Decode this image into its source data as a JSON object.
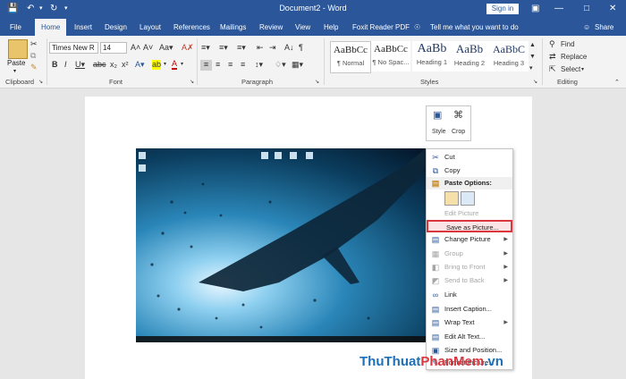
{
  "titlebar": {
    "title": "Document2 - Word",
    "sign_in": "Sign in"
  },
  "tabs": [
    "File",
    "Home",
    "Insert",
    "Design",
    "Layout",
    "References",
    "Mailings",
    "Review",
    "View",
    "Help",
    "Foxit Reader PDF"
  ],
  "tell_me": "Tell me what you want to do",
  "share": "Share",
  "ribbon": {
    "clipboard": {
      "paste": "Paste",
      "label": "Clipboard"
    },
    "font": {
      "name": "Times New R",
      "size": "14",
      "label": "Font"
    },
    "paragraph": {
      "label": "Paragraph"
    },
    "styles": {
      "label": "Styles",
      "items": [
        {
          "preview": "AaBbCc",
          "name": "¶ Normal"
        },
        {
          "preview": "AaBbCc",
          "name": "¶ No Spac..."
        },
        {
          "preview": "AaBb",
          "name": "Heading 1"
        },
        {
          "preview": "AaBb",
          "name": "Heading 2"
        },
        {
          "preview": "AaBbC",
          "name": "Heading 3"
        }
      ]
    },
    "editing": {
      "find": "Find",
      "replace": "Replace",
      "select": "Select",
      "label": "Editing"
    }
  },
  "layout_popup": {
    "style": "Style",
    "crop": "Crop"
  },
  "context_menu": [
    {
      "label": "Cut",
      "icon": "scissors-icon",
      "disabled": false
    },
    {
      "label": "Copy",
      "icon": "copy-icon",
      "disabled": false
    },
    {
      "label": "Paste Options:",
      "icon": "paste-icon",
      "disabled": false
    },
    {
      "label": "Edit Picture",
      "icon": "",
      "disabled": true
    },
    {
      "label": "Save as Picture...",
      "icon": "",
      "disabled": false
    },
    {
      "label": "Change Picture",
      "icon": "change-picture-icon",
      "disabled": false
    },
    {
      "label": "Group",
      "icon": "group-icon",
      "disabled": true
    },
    {
      "label": "Bring to Front",
      "icon": "bring-front-icon",
      "disabled": true
    },
    {
      "label": "Send to Back",
      "icon": "send-back-icon",
      "disabled": true
    },
    {
      "label": "Link",
      "icon": "link-icon",
      "disabled": false
    },
    {
      "label": "Insert Caption...",
      "icon": "caption-icon",
      "disabled": false
    },
    {
      "label": "Wrap Text",
      "icon": "wrap-text-icon",
      "disabled": false
    },
    {
      "label": "Edit Alt Text...",
      "icon": "alt-text-icon",
      "disabled": false
    },
    {
      "label": "Size and Position...",
      "icon": "size-position-icon",
      "disabled": false
    },
    {
      "label": "Format Picture...",
      "icon": "format-picture-icon",
      "disabled": false
    }
  ],
  "watermark": {
    "part1": "ThuThuat",
    "part2": "PhanMem",
    "part3": ".vn"
  },
  "colors": {
    "word_blue": "#2b579a",
    "highlight_red": "#d9363e"
  }
}
